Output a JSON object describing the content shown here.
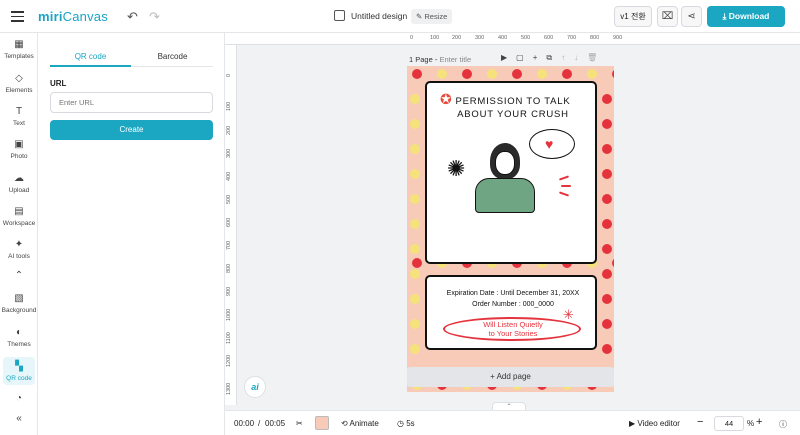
{
  "app": {
    "logo_main": "miri",
    "logo_sub": "Canvas",
    "document_title": "Untitled design",
    "resize_label": "Resize",
    "version_label": "v1 전환",
    "download_label": "Download"
  },
  "rail": {
    "items": [
      {
        "label": "Templates",
        "icon": "templates-icon"
      },
      {
        "label": "Elements",
        "icon": "elements-icon"
      },
      {
        "label": "Text",
        "icon": "text-icon"
      },
      {
        "label": "Photo",
        "icon": "photo-icon"
      },
      {
        "label": "Upload",
        "icon": "upload-icon"
      },
      {
        "label": "Workspace",
        "icon": "workspace-icon"
      },
      {
        "label": "AI tools",
        "icon": "ai-tools-icon"
      },
      {
        "label": "Background",
        "icon": "background-icon"
      },
      {
        "label": "Themes",
        "icon": "themes-icon"
      },
      {
        "label": "QR code",
        "icon": "qr-code-icon"
      }
    ]
  },
  "panel": {
    "tabs": [
      "QR code",
      "Barcode"
    ],
    "url_label": "URL",
    "url_placeholder": "Enter URL",
    "create_label": "Create"
  },
  "ruler": {
    "top": [
      "0",
      "100",
      "200",
      "300",
      "400",
      "500",
      "600",
      "700",
      "800",
      "900"
    ],
    "left": [
      "0",
      "100",
      "200",
      "300",
      "400",
      "500",
      "600",
      "700",
      "800",
      "900",
      "1000",
      "1100",
      "1200",
      "1300"
    ]
  },
  "page": {
    "label": "1 Page",
    "title_placeholder": "Enter title",
    "add_page_label": "Add page"
  },
  "design": {
    "title_line1": "PERMISSION TO TALK",
    "title_line2": "ABOUT YOUR CRUSH",
    "expiration": "Expiration Date : Until December 31, 20XX",
    "order": "Order Number : 000_0000",
    "promise_line1": "Will Listen Quietly",
    "promise_line2": "to Your Stories"
  },
  "ai_badge": "ai",
  "bottom": {
    "time_current": "00:00",
    "time_sep": "/",
    "time_total": "00:05",
    "animate_label": "Animate",
    "duration": "5s",
    "video_editor_label": "Video editor",
    "zoom_value": "44",
    "zoom_unit": "%"
  },
  "colors": {
    "accent": "#1ba6c2",
    "card_bg": "#f8cbb8",
    "heart_red": "#e5333d",
    "heart_yellow": "#f5e27a"
  }
}
